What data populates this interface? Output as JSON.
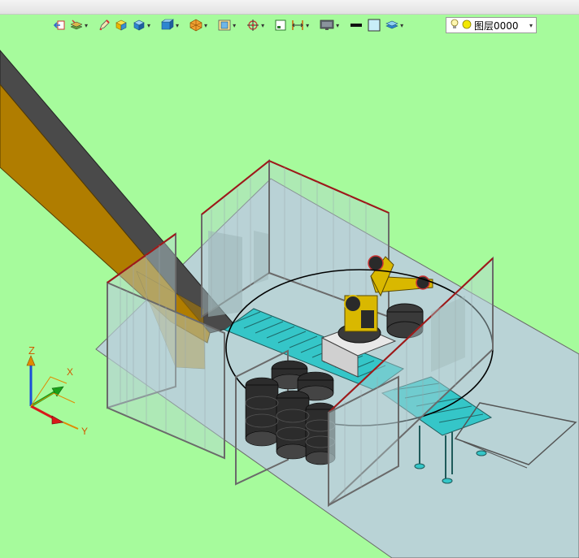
{
  "colors": {
    "viewport_bg": "#a6fb9c",
    "floor": "#b9d3d6",
    "chute_dark": "#4a4a4a",
    "chute_brown": "#b07d00",
    "conveyor_rollers": "#35c6c8",
    "fence_frame": "#6a6a6a",
    "fence_accent": "#a01818",
    "robot_body": "#d9b800",
    "tire": "#2c2c2c"
  },
  "toolbar": {
    "icons": [
      {
        "name": "view-back-icon"
      },
      {
        "name": "layers-manager-icon",
        "dropdown": true
      },
      {
        "name": "pencil-icon"
      },
      {
        "name": "solid-yellow-cube-icon"
      },
      {
        "name": "shaded-cube-icon",
        "dropdown": true
      },
      {
        "name": "view-direction-icon",
        "dropdown": true
      },
      {
        "name": "render-style-icon",
        "dropdown": true
      },
      {
        "name": "fit-view-icon",
        "dropdown": true
      },
      {
        "name": "origin-target-icon",
        "dropdown": true
      },
      {
        "name": "frame-icon"
      },
      {
        "name": "dimension-icon",
        "dropdown": true
      },
      {
        "name": "monitor-icon",
        "dropdown": true
      },
      {
        "name": "line-color-icon"
      },
      {
        "name": "fill-color-icon"
      },
      {
        "name": "layer-stack-icon",
        "dropdown": true
      }
    ],
    "layer_selector": {
      "light_icon": "lightbulb-icon",
      "status_icon": "layer-on-icon",
      "value": "图层0000"
    }
  },
  "axis_triad": {
    "z_label": "Z",
    "x_label": "X",
    "y_label": "Y"
  }
}
